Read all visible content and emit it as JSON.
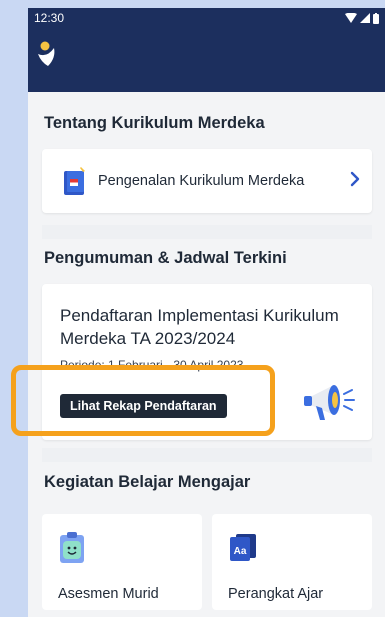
{
  "status_bar": {
    "time": "12:30"
  },
  "sections": {
    "tentang_title": "Tentang Kurikulum Merdeka",
    "pengumuman_title": "Pengumuman & Jadwal Terkini",
    "kegiatan_title": "Kegiatan Belajar Mengajar"
  },
  "kurikulum_card": {
    "label": "Pengenalan Kurikulum Merdeka"
  },
  "announcement": {
    "title": "Pendaftaran Implementasi Kurikulum Merdeka TA 2023/2024",
    "date_range": "Periode: 1 Februari - 30 April 2023",
    "button_label": "Lihat Rekap Pendaftaran"
  },
  "tiles": [
    {
      "label": "Asesmen Murid",
      "icon": "assessment-icon"
    },
    {
      "label": "Perangkat Ajar",
      "icon": "teaching-materials-icon"
    }
  ],
  "colors": {
    "header": "#1c2f5e",
    "highlight": "#f5a11c",
    "accent_blue": "#2f57c7",
    "button_dark": "#1f2937"
  }
}
